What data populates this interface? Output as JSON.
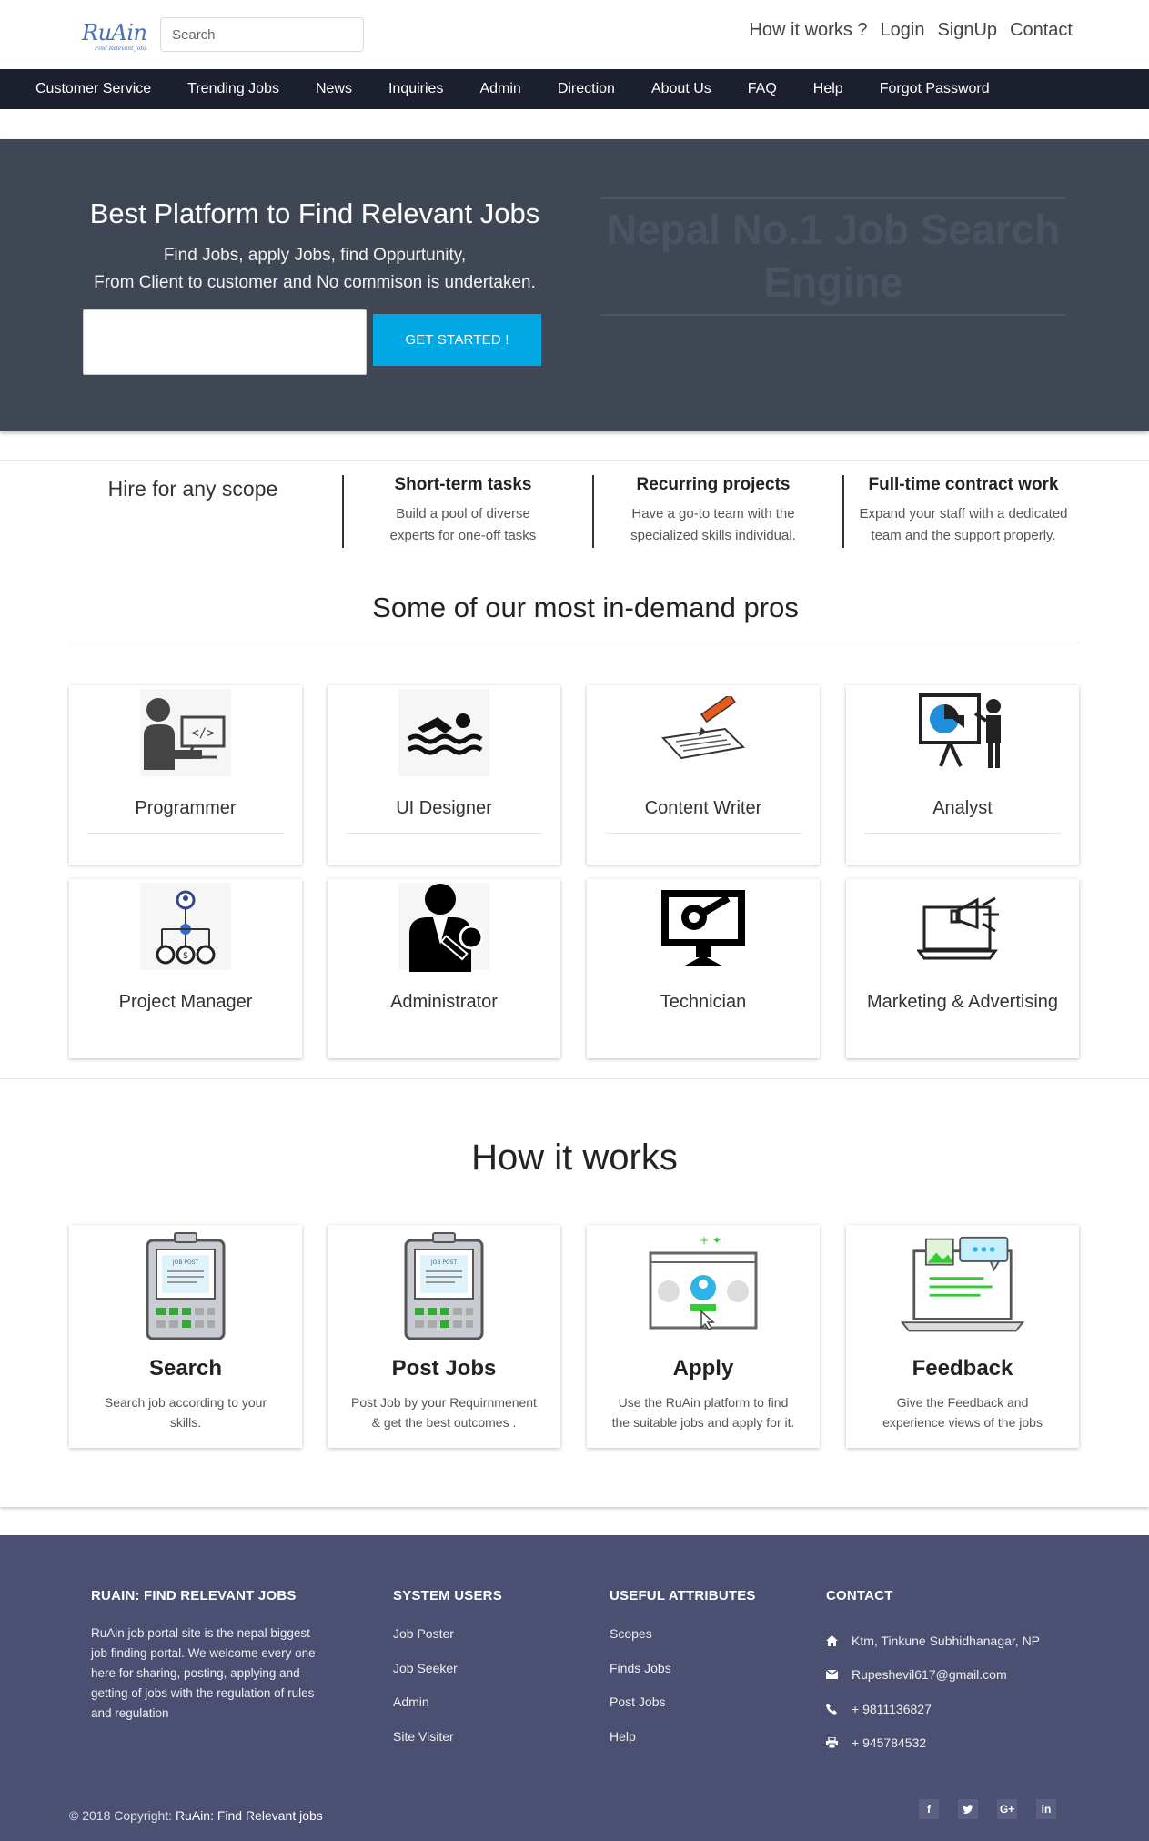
{
  "header": {
    "logo_text": "RuAin",
    "logo_tagline": "Find Relevant Jobs",
    "search_placeholder": "Search",
    "links": [
      "How it works ?",
      "Login",
      "SignUp",
      "Contact"
    ]
  },
  "nav": {
    "items": [
      "Customer Service",
      "Trending Jobs",
      "News",
      "Inquiries",
      "Admin",
      "Direction",
      "About Us",
      "FAQ",
      "Help",
      "Forgot Password"
    ]
  },
  "hero": {
    "title": "Best Platform to Find Relevant Jobs",
    "subtitle_line1": "Find Jobs, apply Jobs, find Oppurtunity,",
    "subtitle_line2": "From Client to customer and No commison is undertaken.",
    "input_value": "",
    "button_label": "GET STARTED !",
    "brand_text": "Nepal No.1 Job Search Engine",
    "colors": {
      "background": "#3f4654",
      "button": "#00a8e6"
    }
  },
  "scope": {
    "title": "Hire for any scope",
    "items": [
      {
        "title": "Short-term tasks",
        "desc_line1": "Build a pool of diverse",
        "desc_line2": "experts for one-off tasks"
      },
      {
        "title": "Recurring projects",
        "desc_line1": "Have a go-to team with the",
        "desc_line2": "specialized skills individual."
      },
      {
        "title": "Full-time contract work",
        "desc_line1": "Expand your staff with a dedicated",
        "desc_line2": "team and the support properly."
      }
    ]
  },
  "pros": {
    "title": "Some of our most in-demand pros",
    "items": [
      {
        "label": "Programmer",
        "icon": "programmer-icon"
      },
      {
        "label": "UI Designer",
        "icon": "swimmer-icon"
      },
      {
        "label": "Content Writer",
        "icon": "writing-icon"
      },
      {
        "label": "Analyst",
        "icon": "presentation-chart-icon"
      },
      {
        "label": "Project Manager",
        "icon": "org-chart-icon"
      },
      {
        "label": "Administrator",
        "icon": "admin-key-icon"
      },
      {
        "label": "Technician",
        "icon": "monitor-tools-icon"
      },
      {
        "label": "Marketing & Advertising",
        "icon": "laptop-megaphone-icon"
      }
    ]
  },
  "how": {
    "title": "How it works",
    "steps": [
      {
        "title": "Search",
        "desc_line1": "Search job according to your",
        "desc_line2": "skills.",
        "icon": "job-post-board-icon"
      },
      {
        "title": "Post Jobs",
        "desc_line1": "Post Job by your Requirnmenent",
        "desc_line2": "&   get the best outcomes .",
        "icon": "job-post-board-icon"
      },
      {
        "title": "Apply",
        "desc_line1": "Use the RuAin platform to find",
        "desc_line2": "the suitable jobs and apply for it.",
        "icon": "apply-window-icon"
      },
      {
        "title": "Feedback",
        "desc_line1": "Give the Feedback and",
        "desc_line2": "experience views of the jobs",
        "icon": "laptop-chat-icon"
      }
    ]
  },
  "footer": {
    "about_heading": "RUAIN: FIND RELEVANT JOBS",
    "about_text": "RuAin job portal site is the nepal biggest job finding portal. We welcome every one here for sharing, posting, applying and getting of jobs with the regulation of rules and regulation",
    "users_heading": "SYSTEM USERS",
    "users": [
      "Job Poster",
      "Job Seeker",
      "Admin",
      "Site Visiter"
    ],
    "attrs_heading": "USEFUL ATTRIBUTES",
    "attrs": [
      "Scopes",
      "Finds Jobs",
      "Post Jobs",
      "Help"
    ],
    "contact_heading": "CONTACT",
    "contact": {
      "address": "Ktm, Tinkune Subhidhanagar, NP",
      "email": "Rupeshevil617@gmail.com",
      "phone": "+ 9811136827",
      "fax": "+ 945784532"
    },
    "copyright_prefix": "© 2018 Copyright: ",
    "copyright_brand": "RuAin: Find Relevant jobs",
    "socials": [
      "f",
      "t",
      "G+",
      "in"
    ],
    "colors": {
      "background": "#4b4f72"
    }
  }
}
